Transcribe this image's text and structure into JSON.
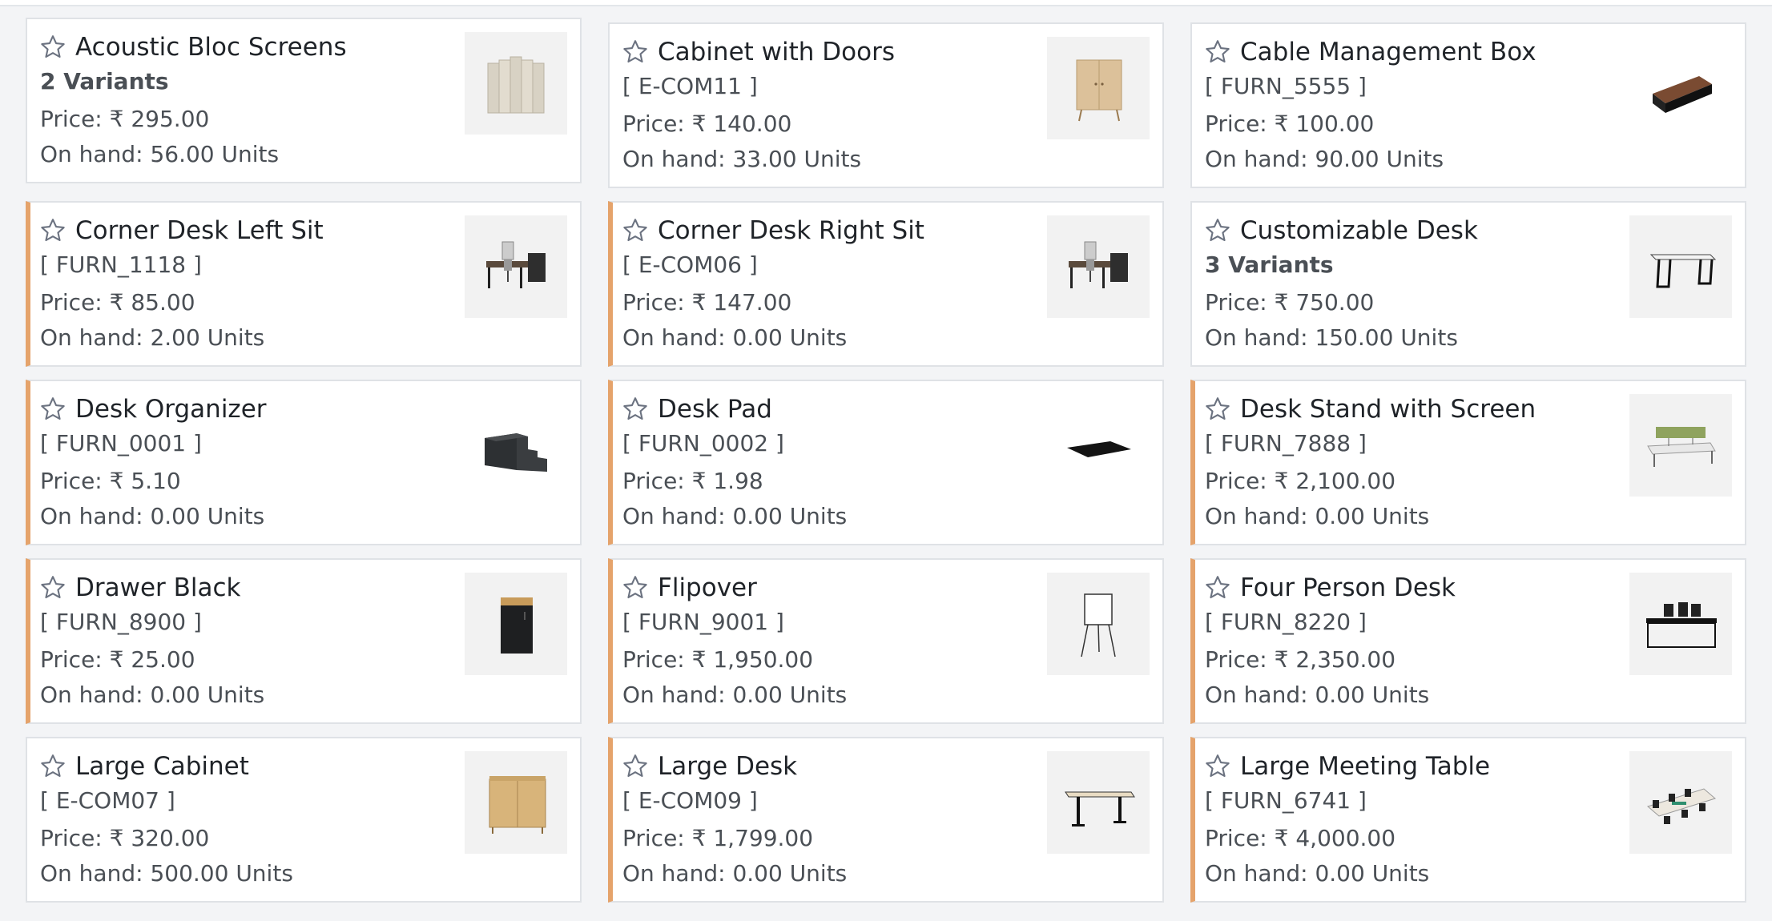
{
  "products": [
    {
      "name": "Acoustic Bloc Screens",
      "sub": "2 Variants",
      "variants": true,
      "price": "Price: ₹ 295.00",
      "onhand": "On hand: 56.00 Units",
      "accent": false,
      "icon": "acoustic-screen-icon"
    },
    {
      "name": "Cabinet with Doors",
      "sub": "[ E-COM11 ]",
      "variants": false,
      "price": "Price: ₹ 140.00",
      "onhand": "On hand: 33.00 Units",
      "accent": false,
      "icon": "cabinet-doors-icon"
    },
    {
      "name": "Cable Management Box",
      "sub": "[ FURN_5555 ]",
      "variants": false,
      "price": "Price: ₹ 100.00",
      "onhand": "On hand: 90.00 Units",
      "accent": false,
      "icon": "cable-box-icon"
    },
    {
      "name": "Corner Desk Left Sit",
      "sub": "[ FURN_1118 ]",
      "variants": false,
      "price": "Price: ₹ 85.00",
      "onhand": "On hand: 2.00 Units",
      "accent": true,
      "icon": "corner-desk-icon"
    },
    {
      "name": "Corner Desk Right Sit",
      "sub": "[ E-COM06 ]",
      "variants": false,
      "price": "Price: ₹ 147.00",
      "onhand": "On hand: 0.00 Units",
      "accent": true,
      "icon": "corner-desk-icon"
    },
    {
      "name": "Customizable Desk",
      "sub": "3 Variants",
      "variants": true,
      "price": "Price: ₹ 750.00",
      "onhand": "On hand: 150.00 Units",
      "accent": false,
      "icon": "desk-icon"
    },
    {
      "name": "Desk Organizer",
      "sub": "[ FURN_0001 ]",
      "variants": false,
      "price": "Price: ₹ 5.10",
      "onhand": "On hand: 0.00 Units",
      "accent": true,
      "icon": "desk-organizer-icon"
    },
    {
      "name": "Desk Pad",
      "sub": "[ FURN_0002 ]",
      "variants": false,
      "price": "Price: ₹ 1.98",
      "onhand": "On hand: 0.00 Units",
      "accent": true,
      "icon": "desk-pad-icon"
    },
    {
      "name": "Desk Stand with Screen",
      "sub": "[ FURN_7888 ]",
      "variants": false,
      "price": "Price: ₹ 2,100.00",
      "onhand": "On hand: 0.00 Units",
      "accent": true,
      "icon": "desk-stand-screen-icon"
    },
    {
      "name": "Drawer Black",
      "sub": "[ FURN_8900 ]",
      "variants": false,
      "price": "Price: ₹ 25.00",
      "onhand": "On hand: 0.00 Units",
      "accent": true,
      "icon": "drawer-icon"
    },
    {
      "name": "Flipover",
      "sub": "[ FURN_9001 ]",
      "variants": false,
      "price": "Price: ₹ 1,950.00",
      "onhand": "On hand: 0.00 Units",
      "accent": true,
      "icon": "flipchart-icon"
    },
    {
      "name": "Four Person Desk",
      "sub": "[ FURN_8220 ]",
      "variants": false,
      "price": "Price: ₹ 2,350.00",
      "onhand": "On hand: 0.00 Units",
      "accent": true,
      "icon": "four-person-desk-icon"
    },
    {
      "name": "Large Cabinet",
      "sub": "[ E-COM07 ]",
      "variants": false,
      "price": "Price: ₹ 320.00",
      "onhand": "On hand: 500.00 Units",
      "accent": false,
      "icon": "large-cabinet-icon"
    },
    {
      "name": "Large Desk",
      "sub": "[ E-COM09 ]",
      "variants": false,
      "price": "Price: ₹ 1,799.00",
      "onhand": "On hand: 0.00 Units",
      "accent": true,
      "icon": "large-desk-icon"
    },
    {
      "name": "Large Meeting Table",
      "sub": "[ FURN_6741 ]",
      "variants": false,
      "price": "Price: ₹ 4,000.00",
      "onhand": "On hand: 0.00 Units",
      "accent": true,
      "icon": "meeting-table-icon"
    }
  ],
  "colors": {
    "accent": "#e5a36b",
    "card_border": "#dfe2e6",
    "background": "#f3f4f6"
  }
}
